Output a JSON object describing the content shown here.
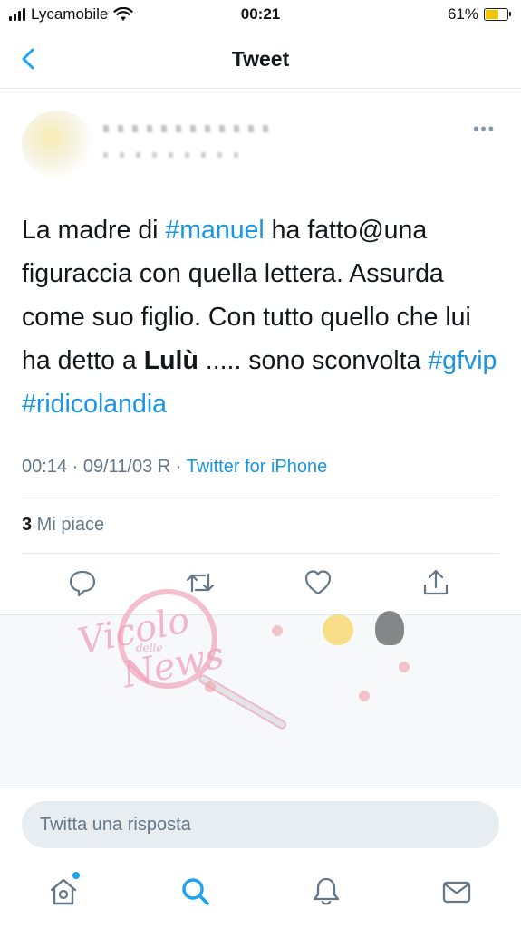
{
  "status_bar": {
    "carrier": "Lycamobile",
    "time": "00:21",
    "battery_percent": "61%",
    "battery_level": 0.61,
    "battery_color": "#f5c400"
  },
  "nav": {
    "title": "Tweet",
    "back_icon": "chevron-left-icon"
  },
  "tweet": {
    "segments": {
      "t1": "La madre di ",
      "t2": "#manuel",
      "t3": " ha fatto@una figuraccia con quella lettera. Assurda come suo figlio. Con tutto quello che lui ha detto a ",
      "t4": "Lulù",
      "t5": " ..... sono sconvolta ",
      "t6": "#gfvip",
      "t7": " ",
      "t8": "#ridicolandia"
    },
    "time": "00:14 · 09/11/03 R · ",
    "source": "Twitter for iPhone",
    "likes_count": "3",
    "likes_label": " Mi piace",
    "link_color": "#1b95e0"
  },
  "actions": [
    "reply-icon",
    "retweet-icon",
    "like-icon",
    "share-icon"
  ],
  "reply_bar": {
    "placeholder": "Twitta una risposta"
  },
  "tab_bar": [
    "home-icon",
    "search-icon",
    "notifications-icon",
    "messages-icon"
  ],
  "watermark": {
    "title": "Vicolo",
    "subtitle": "delle",
    "title2": "News"
  },
  "colors": {
    "accent": "#1da1f2",
    "text_secondary": "#657786",
    "divider": "#e1e8ed"
  }
}
